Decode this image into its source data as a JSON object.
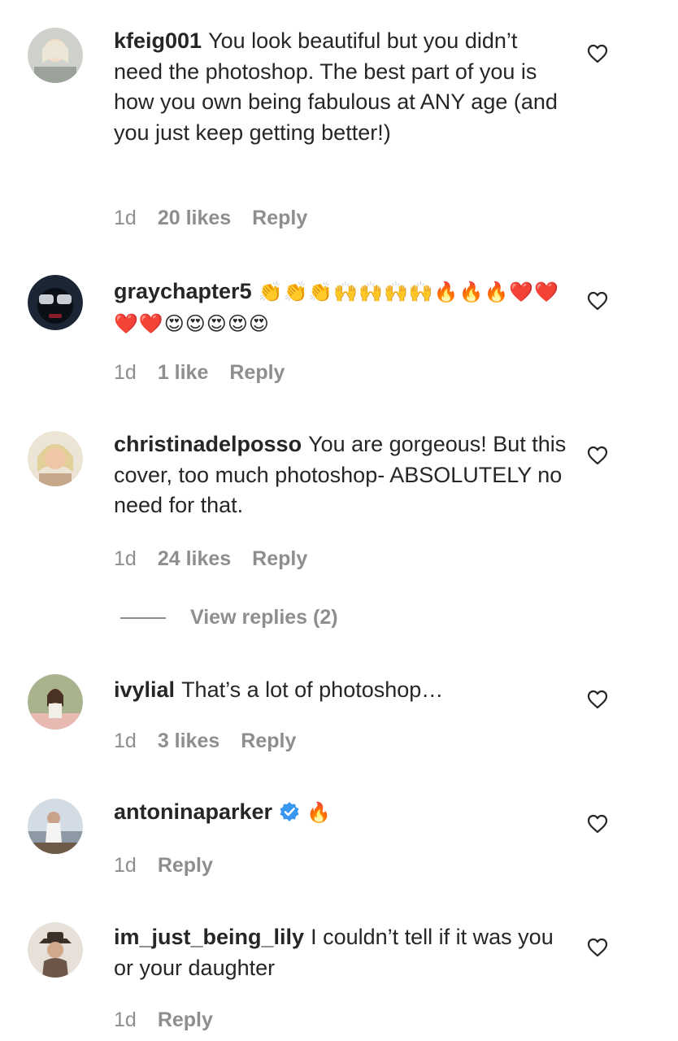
{
  "comments": [
    {
      "username": "kfeig001",
      "text": "You look beautiful but you didn’t need the photoshop. The best part of you is how you own being fabulous at ANY age (and you just keep getting better!)",
      "time": "1d",
      "likes": "20 likes",
      "reply": "Reply"
    },
    {
      "username": "graychapter5",
      "text": "👏👏👏🙌🙌🙌🙌🔥🔥🔥❤️❤️❤️❤️😍😍😍😍😍",
      "time": "1d",
      "likes": "1 like",
      "reply": "Reply"
    },
    {
      "username": "christinadelposso",
      "text": "You are gorgeous! But this cover, too much photoshop- ABSOLUTELY no need for that.",
      "time": "1d",
      "likes": "24 likes",
      "reply": "Reply"
    },
    {
      "username": "ivylial",
      "text": "That’s a lot of photoshop…",
      "time": "1d",
      "likes": "3 likes",
      "reply": "Reply"
    },
    {
      "username": "antoninaparker",
      "text": "🔥",
      "time": "1d",
      "likes": "",
      "reply": "Reply",
      "verified": true
    },
    {
      "username": "im_just_being_lily",
      "text": "I couldn’t tell if it was you or your daughter",
      "time": "1d",
      "likes": "",
      "reply": "Reply"
    }
  ],
  "view_replies": "View replies (2)",
  "colors": {
    "text": "#262626",
    "secondary": "#8e8e8e",
    "verified": "#3897f0"
  }
}
